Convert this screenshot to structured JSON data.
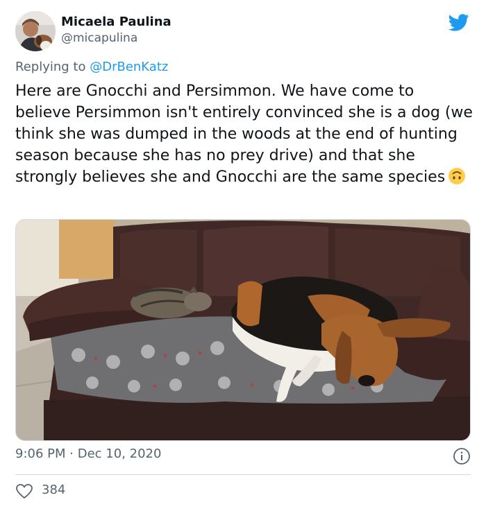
{
  "author": {
    "display_name": "Micaela Paulina",
    "handle": "@micapulina",
    "avatar_icon": "avatar-photo"
  },
  "brand": {
    "icon": "twitter-bird-icon",
    "color": "#1d9bf0"
  },
  "reply": {
    "prefix": "Replying to",
    "mention": "@DrBenKatz"
  },
  "tweet": {
    "text": "Here are Gnocchi and Persimmon. We have come to believe Persimmon isn't entirely convinced she is a dog (we think she was dumped in the woods at the end of hunting season because she has no prey drive) and that she strongly believes she and Gnocchi are the same species",
    "emoji": "upside-down-face-emoji",
    "photo": "photo of a tabby cat and a beagle lying on a brown leather couch"
  },
  "timestamp": {
    "time": "9:06 PM",
    "separator": "·",
    "date": "Dec 10, 2020"
  },
  "actions": {
    "likes": "384",
    "like_icon": "heart-icon",
    "info_icon": "info-icon"
  }
}
